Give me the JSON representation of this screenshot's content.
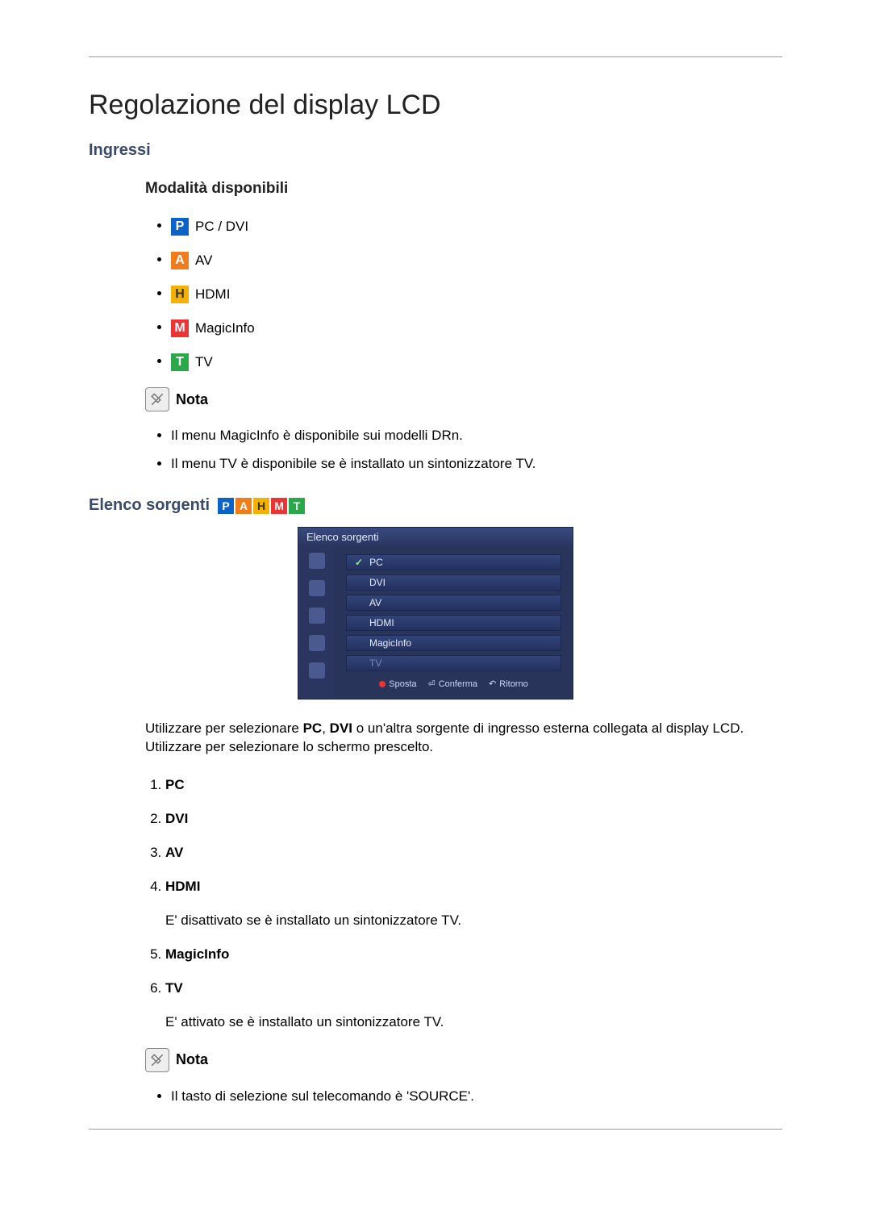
{
  "title": "Regolazione del display LCD",
  "section_ingressi": "Ingressi",
  "modes_heading": "Modalità disponibili",
  "modes": [
    {
      "icon": "P",
      "label": "PC / DVI"
    },
    {
      "icon": "A",
      "label": "AV"
    },
    {
      "icon": "H",
      "label": "HDMI"
    },
    {
      "icon": "M",
      "label": "MagicInfo"
    },
    {
      "icon": "T",
      "label": "TV"
    }
  ],
  "note_label": "Nota",
  "note_items_1": [
    "Il menu MagicInfo è disponibile sui modelli DRn.",
    "Il menu TV è disponibile se è installato un sintonizzatore TV."
  ],
  "elenco_heading": "Elenco sorgenti",
  "osd": {
    "title": "Elenco sorgenti",
    "items": [
      {
        "label": "PC",
        "selected": true
      },
      {
        "label": "DVI",
        "selected": false
      },
      {
        "label": "AV",
        "selected": false
      },
      {
        "label": "HDMI",
        "selected": false
      },
      {
        "label": "MagicInfo",
        "selected": false
      },
      {
        "label": "TV",
        "selected": false,
        "dim": true
      }
    ],
    "footer": {
      "sposta": "Sposta",
      "conferma": "Conferma",
      "ritorno": "Ritorno"
    }
  },
  "para_pre_usare": "Utilizzare per selezionare ",
  "para_pc": "PC",
  "para_sep": ", ",
  "para_dvi": "DVI",
  "para_post_usare": " o un'altra sorgente di ingresso esterna collegata al display LCD. Utilizzare per selezionare lo schermo prescelto.",
  "numbered": [
    {
      "label": "PC"
    },
    {
      "label": "DVI"
    },
    {
      "label": "AV"
    },
    {
      "label": "HDMI",
      "note": "E' disattivato se è installato un sintonizzatore TV."
    },
    {
      "label": "MagicInfo"
    },
    {
      "label": "TV",
      "note": "E' attivato se è installato un sintonizzatore TV."
    }
  ],
  "note_items_2": [
    "Il tasto di selezione sul telecomando è 'SOURCE'."
  ]
}
